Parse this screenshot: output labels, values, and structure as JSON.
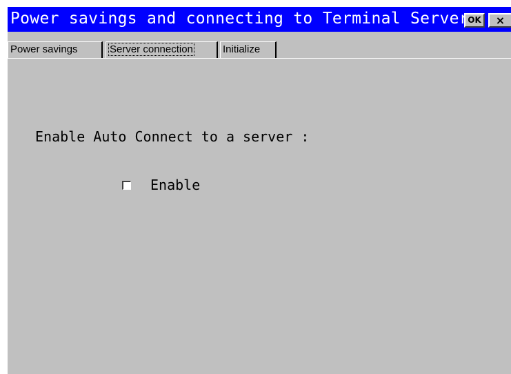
{
  "window": {
    "title": "Power savings and connecting to Terminal Server",
    "ok_label": "OK",
    "close_label": "×"
  },
  "tabs": [
    {
      "label": "Power savings",
      "selected": false
    },
    {
      "label": "Server connection",
      "selected": true
    },
    {
      "label": "Initialize",
      "selected": false
    }
  ],
  "content": {
    "section_label": "Enable Auto Connect to a server :",
    "enable_checkbox": {
      "label": "Enable",
      "checked": false
    }
  },
  "colors": {
    "titlebar": "#0000ff",
    "title_text": "#ffffff",
    "panel": "#c0c0c0"
  }
}
